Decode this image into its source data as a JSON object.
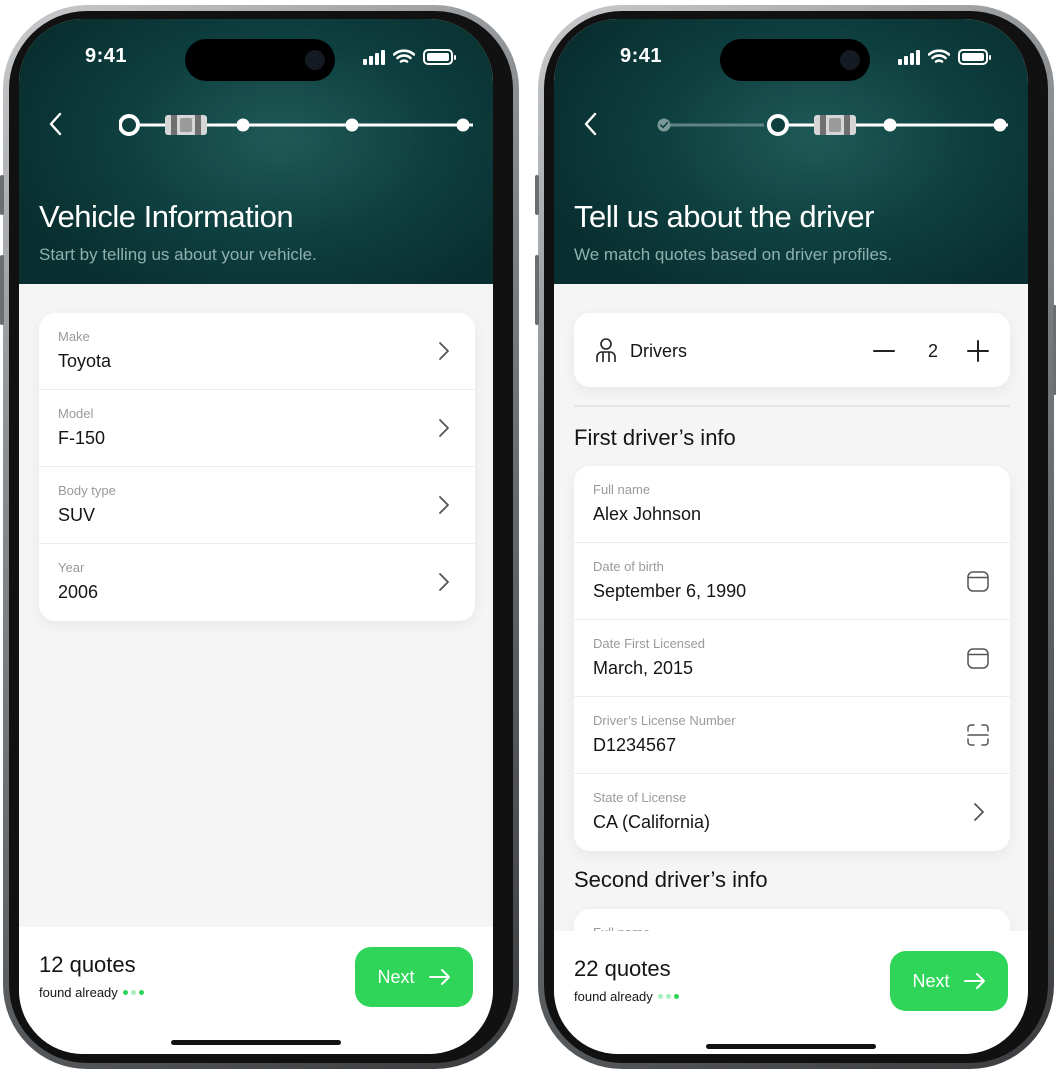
{
  "colors": {
    "header_dark": "#092e2f",
    "header_mid": "#1f5a57",
    "accent_green": "#2fd558",
    "background": "#f5f5f5"
  },
  "screens": [
    {
      "status": {
        "time": "9:41"
      },
      "progress": {
        "steps": 4,
        "current_step": 1,
        "completed_steps": 0
      },
      "title": "Vehicle Information",
      "subtitle": "Start by telling us about your vehicle.",
      "vehicle_fields": [
        {
          "label": "Make",
          "value": "Toyota",
          "icon": "chevron-right-icon"
        },
        {
          "label": "Model",
          "value": "F-150",
          "icon": "chevron-right-icon"
        },
        {
          "label": "Body type",
          "value": "SUV",
          "icon": "chevron-right-icon"
        },
        {
          "label": "Year",
          "value": "2006",
          "icon": "chevron-right-icon"
        }
      ],
      "footer": {
        "quotes": "12 quotes",
        "found": "found already",
        "next_label": "Next"
      }
    },
    {
      "status": {
        "time": "9:41"
      },
      "progress": {
        "steps": 4,
        "current_step": 2,
        "completed_steps": 1
      },
      "title": "Tell us about the driver",
      "subtitle": "We match quotes based on driver profiles.",
      "drivers": {
        "label": "Drivers",
        "count": "2"
      },
      "first_driver": {
        "heading": "First driver’s info",
        "fields": [
          {
            "label": "Full name",
            "value": "Alex Johnson",
            "icon": ""
          },
          {
            "label": "Date of birth",
            "value": "September 6, 1990",
            "icon": "calendar-icon"
          },
          {
            "label": "Date First Licensed",
            "value": "March, 2015",
            "icon": "calendar-icon"
          },
          {
            "label": "Driver’s License Number",
            "value": "D1234567",
            "icon": "scan-icon"
          },
          {
            "label": "State of License",
            "value": "CA (California)",
            "icon": "chevron-right-icon"
          }
        ]
      },
      "second_driver": {
        "heading": "Second driver’s info",
        "first_field_label": "Full name"
      },
      "footer": {
        "quotes": "22 quotes",
        "found": "found already",
        "next_label": "Next"
      }
    }
  ]
}
